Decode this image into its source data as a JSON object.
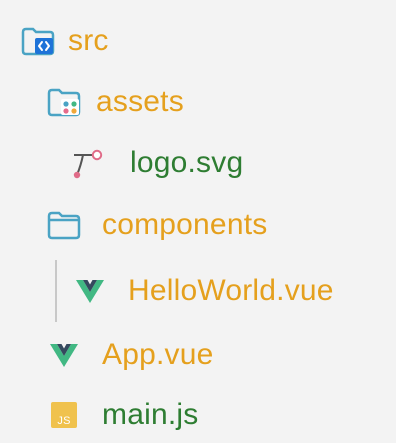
{
  "tree": {
    "items": [
      {
        "name": "src",
        "kind": "folder",
        "icon": "folder-source-icon",
        "color": "#e5a01d"
      },
      {
        "name": "assets",
        "kind": "folder",
        "icon": "folder-assets-icon",
        "color": "#e5a01d"
      },
      {
        "name": "logo.svg",
        "kind": "file",
        "icon": "svg-file-icon",
        "color": "#2e7d32"
      },
      {
        "name": "components",
        "kind": "folder",
        "icon": "folder-icon",
        "color": "#e5a01d"
      },
      {
        "name": "HelloWorld.vue",
        "kind": "file",
        "icon": "vue-icon",
        "color": "#e5a01d"
      },
      {
        "name": "App.vue",
        "kind": "file",
        "icon": "vue-icon",
        "color": "#e5a01d"
      },
      {
        "name": "main.js",
        "kind": "file",
        "icon": "js-file-icon",
        "color": "#2e7d32"
      }
    ]
  },
  "colors": {
    "folder_label": "#e5a01d",
    "file_label": "#2e7d32",
    "folder_icon": "#4aa3c4",
    "vue_green": "#41b883",
    "vue_dark": "#35495e",
    "js_badge": "#f0c24d"
  },
  "icons": {
    "js_badge_text": "JS"
  }
}
